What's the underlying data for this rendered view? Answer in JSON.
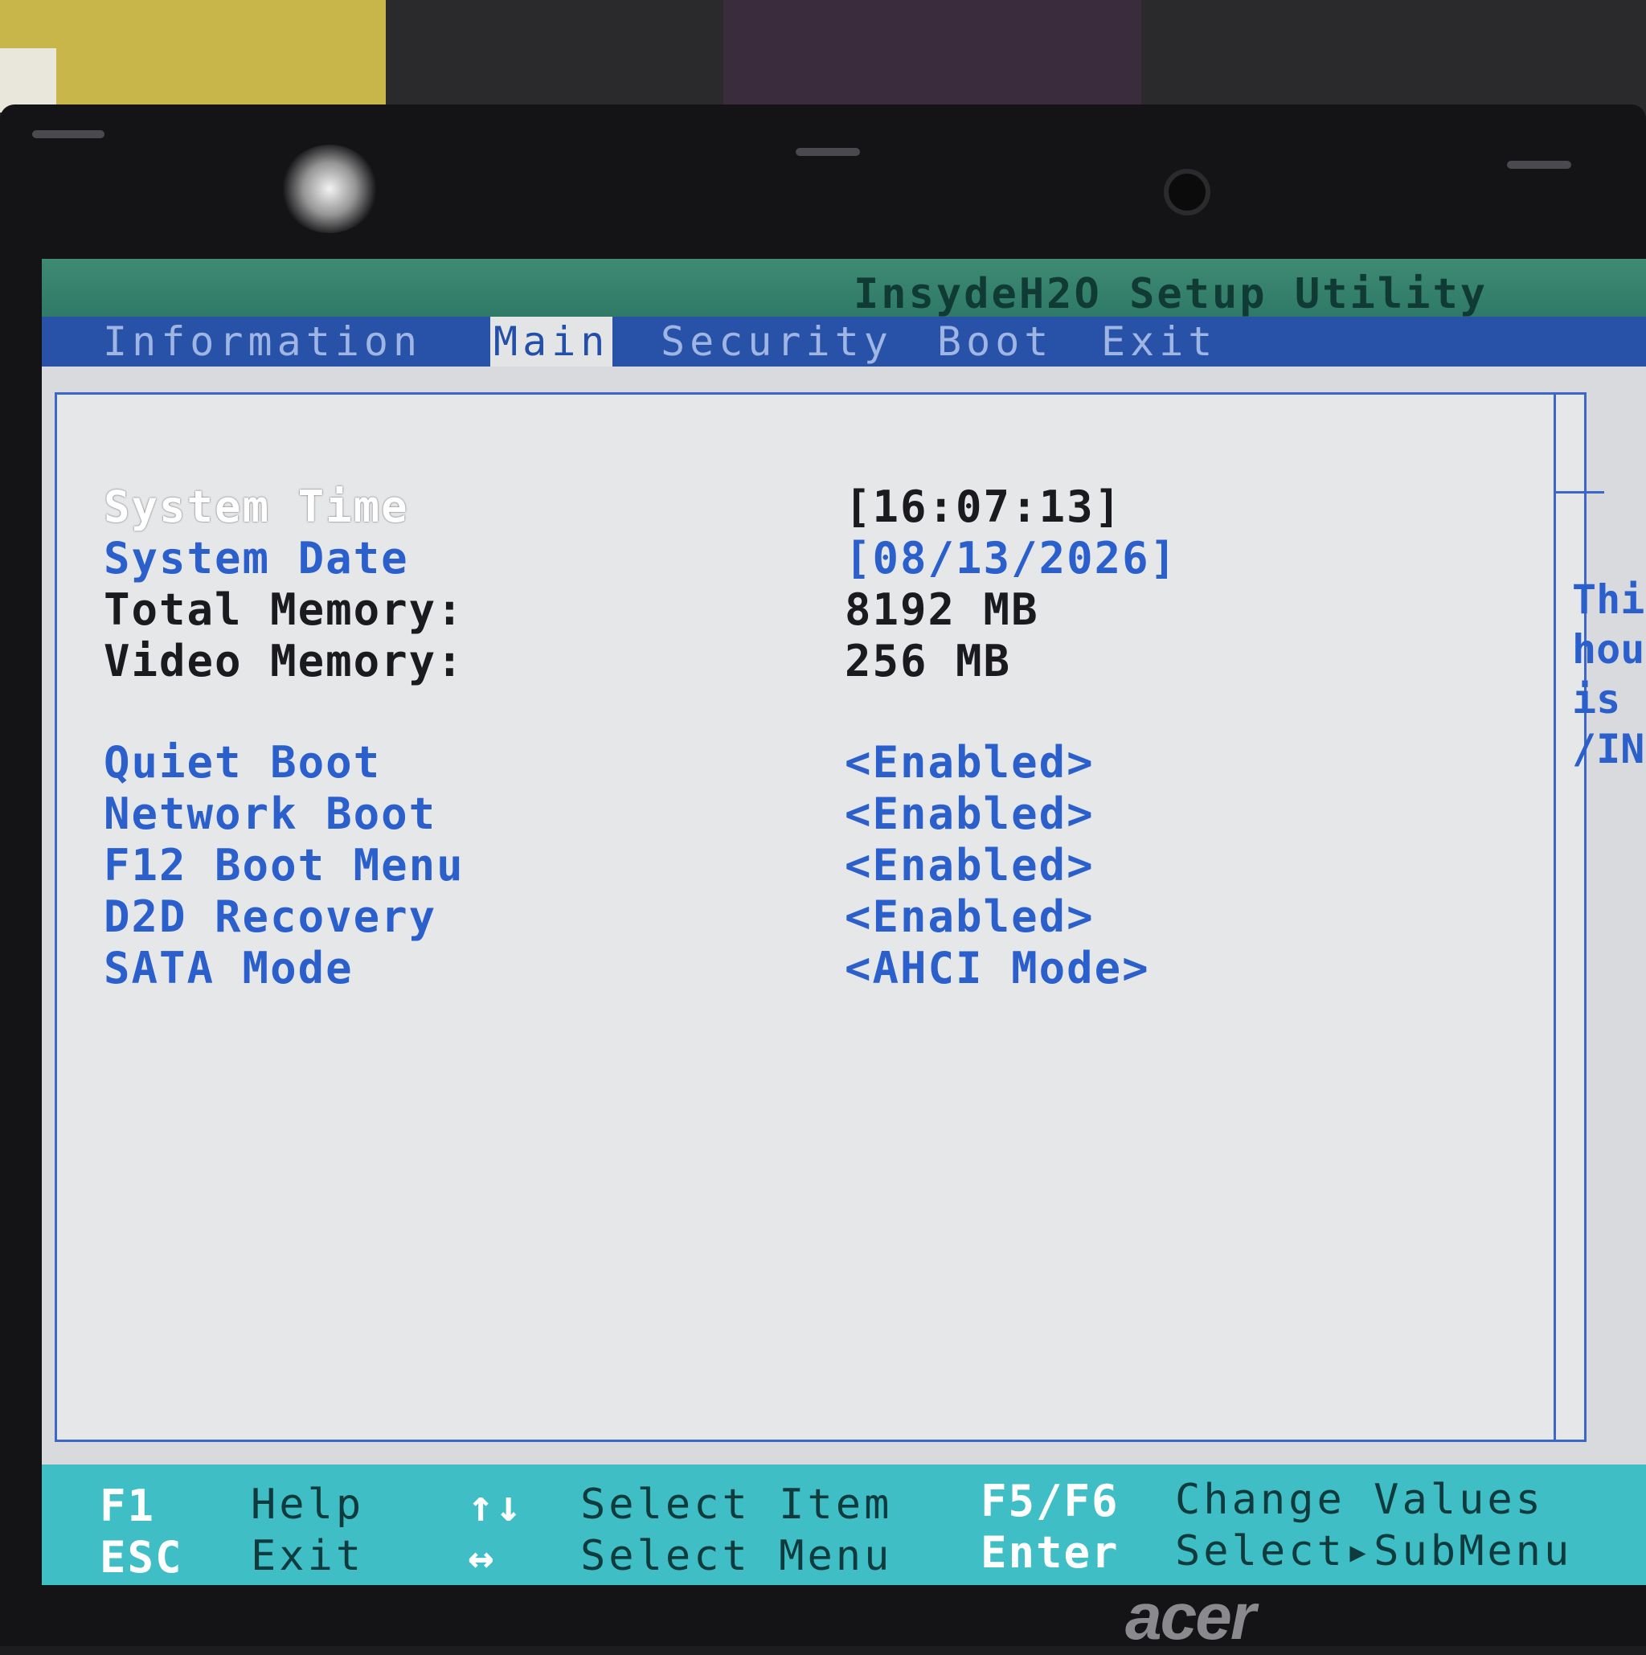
{
  "header": {
    "title": "InsydeH2O Setup Utility"
  },
  "tabs": [
    {
      "label": "Information",
      "active": false
    },
    {
      "label": "Main",
      "active": true
    },
    {
      "label": "Security",
      "active": false
    },
    {
      "label": "Boot",
      "active": false
    },
    {
      "label": "Exit",
      "active": false
    }
  ],
  "settings": [
    {
      "label": "System Time",
      "value": "[16:07:13]"
    },
    {
      "label": "System Date",
      "value": "[08/13/2026]"
    },
    {
      "label": "Total Memory:",
      "value": "8192 MB"
    },
    {
      "label": "Video Memory:",
      "value": "256 MB"
    },
    {
      "label": "Quiet Boot",
      "value": "<Enabled>"
    },
    {
      "label": "Network Boot",
      "value": "<Enabled>"
    },
    {
      "label": "F12 Boot Menu",
      "value": "<Enabled>"
    },
    {
      "label": "D2D Recovery",
      "value": "<Enabled>"
    },
    {
      "label": "SATA Mode",
      "value": "<AHCI Mode>"
    }
  ],
  "help_panel": {
    "lines": [
      "This",
      "hour",
      "is",
      "/IN"
    ]
  },
  "footer": {
    "keys": [
      {
        "key": "F1",
        "desc": "Help"
      },
      {
        "key": "ESC",
        "desc": "Exit"
      },
      {
        "key": "↑↓",
        "desc": "Select Item"
      },
      {
        "key": "↔",
        "desc": "Select Menu"
      },
      {
        "key": "F5/F6",
        "desc": "Change Values"
      },
      {
        "key": "Enter",
        "desc": "Select▸SubMenu"
      }
    ]
  },
  "device": {
    "brand": "acer"
  },
  "colors": {
    "title_bar": "#2f7a67",
    "menu_bar": "#2851a8",
    "content_bg": "#e6e7e9",
    "accent_blue": "#2a5fcc",
    "footer": "#3fbfc5"
  }
}
